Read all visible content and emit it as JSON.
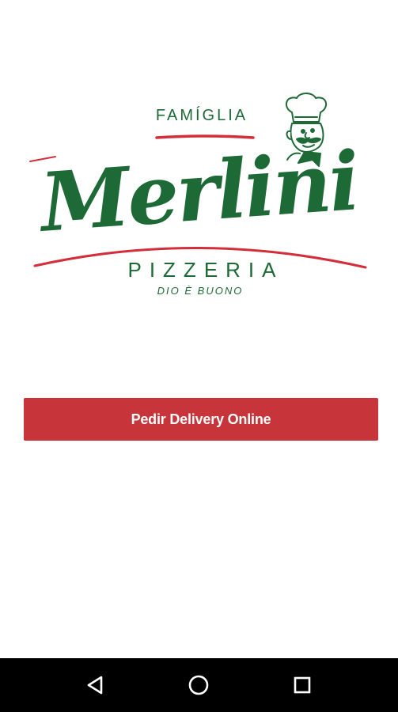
{
  "logo": {
    "top_text": "FAMÍGLIA",
    "main_text": "Merlini",
    "sub_text": "PIZZERIA",
    "tagline": "DIO È BUONO",
    "colors": {
      "green": "#1e6a37",
      "red": "#d32f3a",
      "dark_green": "#145228"
    }
  },
  "cta": {
    "label": "Pedir Delivery Online",
    "color": "#c7343a"
  },
  "navbar": {
    "back_icon": "back-triangle-icon",
    "home_icon": "home-circle-icon",
    "recents_icon": "recents-square-icon"
  }
}
